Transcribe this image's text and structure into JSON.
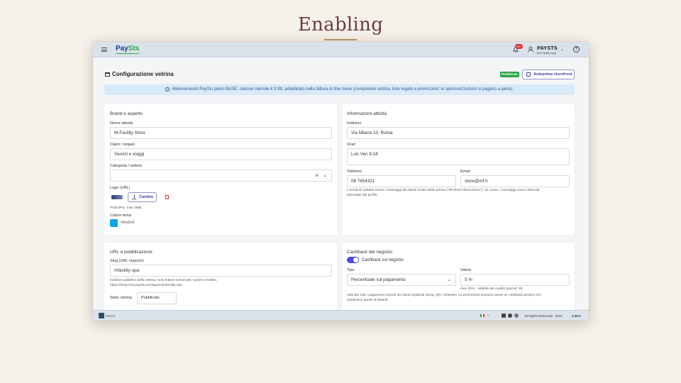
{
  "slide": {
    "title": "Enabling"
  },
  "topbar": {
    "brand_left": "Pay",
    "brand_right": "Sts",
    "notification_count": "99+",
    "user_name": "PAYSTS",
    "user_sub": "(M-Facility spa)",
    "help": "?"
  },
  "page": {
    "title": "Configurazione vetrina",
    "status_badge": "Pubblicato",
    "preview_button": "Anteprima storefront",
    "banner": "Abbonamento PaySts piano BASE: canone mensile € 9.99, addebitato nella fattura di fine mese (comprende vetrina, liste regalo e promozioni; le sponsorizzazioni si pagano a parte)."
  },
  "brand_card": {
    "title": "Brand e aspetto",
    "name_label": "Nome attività",
    "name_value": "M-Facility Store",
    "claim_label": "Claim / slogan",
    "claim_value": "Servizi e viaggi",
    "category_label": "Categoria / settore",
    "category_value": "",
    "logo_label": "Logo (URL)",
    "change_button": "Cambia",
    "logo_hint": "PNG/JPG, max 3MB.",
    "color_label": "Colore tema",
    "color_value": "#0ea5e9"
  },
  "info_card": {
    "title": "Informazioni attività",
    "address_label": "Indirizzo",
    "address_value": "Via Milano 10, Roma",
    "hours_label": "Orari",
    "hours_value": "Lun-Ven 9-18",
    "phone_label": "Telefono",
    "phone_value": "06 7654321",
    "email_label": "Email",
    "email_value": "store@mf.it",
    "email_hint_1": "L'email di contatto riceve i messaggi dei clienti inviati dalla vetrina (\"Richiedi informazioni\"). Se vuota, i messaggi vanno all'email",
    "email_hint_2": "aziendale del profilo."
  },
  "url_card": {
    "title": "URL e pubblicazione",
    "slug_label": "Slug (URL negozio)",
    "slug_value": "mfacility-spa",
    "slug_hint": "Indirizzo pubblico della vetrina. Solo lettere minuscole, numeri e trattini.",
    "slug_url": "https://shop.test.paysts.eu/negozio/mfacility-spa",
    "status_label": "Stato vetrina",
    "status_value": "Pubblicato"
  },
  "cashback_card": {
    "title": "Cashback del negozio",
    "toggle_label": "Cashback sul negozio",
    "type_label": "Tipo",
    "type_value": "Percentuale sul pagamento",
    "value_label": "Valore",
    "value_value": "5 %",
    "value_hint": "max 30% · Validità del credito (giorni): 90",
    "desc_1": "Vale per tutti i pagamenti ricevuti da clienti registrati (shop, QR, richieste). Le promozioni possono avere un cashback proprio che",
    "desc_2": "sostituisce quello di default."
  },
  "footer": {
    "brand": "PAYSTS",
    "rights": "All Rights Reserved - 2024",
    "version": "1.26.0"
  },
  "colors": {
    "accent": "#5046e5",
    "theme": "#0ea5e9",
    "published": "#28a745",
    "slide_title": "#6e3b46"
  }
}
